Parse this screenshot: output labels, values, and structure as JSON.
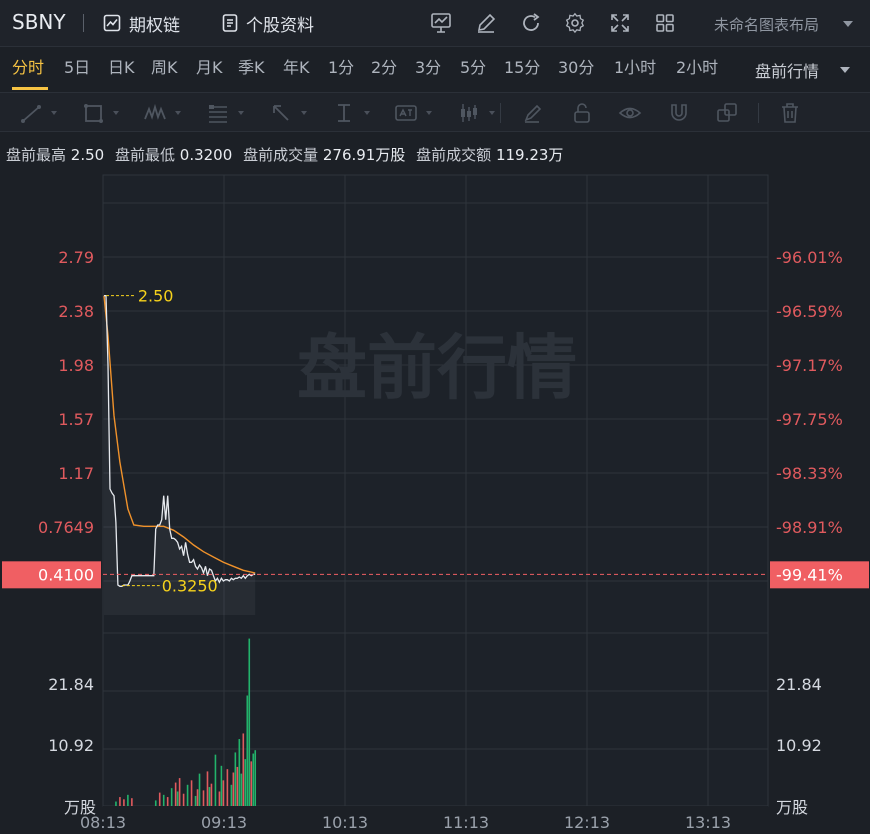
{
  "header": {
    "symbol": "SBNY",
    "option_chain": "期权链",
    "profile": "个股资料",
    "layout_name": "未命名图表布局",
    "icons": [
      "chart-settings-icon",
      "pen-icon",
      "refresh-icon",
      "gear-icon",
      "fullscreen-icon",
      "grid-layout-icon"
    ]
  },
  "periods": {
    "tabs": [
      "分时",
      "5日",
      "日K",
      "周K",
      "月K",
      "季K",
      "年K",
      "1分",
      "2分",
      "3分",
      "5分",
      "15分",
      "30分",
      "1小时",
      "2小时"
    ],
    "active": "分时",
    "session_select": "盘前行情"
  },
  "draw_tools": [
    "line-tool-icon",
    "rectangle-tool-icon",
    "pattern-tool-icon",
    "fib-tool-icon",
    "arrow-tool-icon",
    "measure-tool-icon",
    "text-tool-icon",
    "candle-tool-icon",
    "brush-icon",
    "unlock-icon",
    "eye-icon",
    "magnet-icon",
    "copy-icon",
    "trash-icon"
  ],
  "stats": {
    "high_label": "盘前最高",
    "high": "2.50",
    "low_label": "盘前最低",
    "low": "0.3200",
    "volume_label": "盘前成交量",
    "volume": "276.91万股",
    "turnover_label": "盘前成交额",
    "turnover": "119.23万"
  },
  "colors": {
    "up": "#e05a5e",
    "down": "#22b36b",
    "price_line": "#e6e9ee",
    "avg_line": "#f0922b",
    "marker": "#f6d21c",
    "current_bg": "#f05f63"
  },
  "chart_data": {
    "type": "line",
    "watermark": "盘前行情",
    "price_axis": {
      "ticks": [
        2.79,
        2.38,
        1.98,
        1.57,
        1.17,
        0.7649
      ],
      "tick_labels": [
        "2.79",
        "2.38",
        "1.98",
        "1.57",
        "1.17",
        "0.7649"
      ],
      "pct_labels": [
        "-96.01%",
        "-96.59%",
        "-97.17%",
        "-97.75%",
        "-98.33%",
        "-98.91%"
      ],
      "ylim": [
        0.32,
        3.2
      ]
    },
    "current": {
      "price": 0.41,
      "label": "0.4100",
      "pct": "-99.41%"
    },
    "max_marker": {
      "price": 2.5,
      "label": "2.50"
    },
    "min_marker": {
      "price": 0.325,
      "label": "0.3250"
    },
    "time_axis": {
      "labels": [
        "08:13",
        "09:13",
        "10:13",
        "11:13",
        "12:13",
        "13:13"
      ],
      "start": "08:13",
      "end": "13:43"
    },
    "price_series": {
      "name": "",
      "x": [
        0,
        1,
        2,
        3,
        4,
        5,
        6,
        7,
        8,
        9,
        10,
        11,
        12,
        13,
        14,
        15,
        16,
        17,
        18,
        19,
        20,
        21,
        22,
        23,
        24,
        25,
        26,
        27,
        28,
        29,
        30,
        31,
        32,
        33,
        34,
        35,
        36,
        37,
        38,
        39,
        40,
        41,
        42,
        43,
        44,
        45,
        46,
        47,
        48,
        49,
        50,
        51,
        52,
        53,
        54,
        55,
        56,
        57,
        58,
        59,
        60,
        61,
        62,
        63,
        64,
        65,
        66,
        67,
        68,
        69,
        70,
        71,
        72,
        73,
        74,
        75,
        76
      ],
      "values": [
        2.5,
        2.5,
        1.98,
        1.05,
        1.02,
        1.0,
        0.8,
        0.33,
        0.32,
        0.32,
        0.33,
        0.33,
        0.33,
        0.36,
        0.4,
        0.4,
        0.4,
        0.4,
        0.4,
        0.4,
        0.4,
        0.4,
        0.4,
        0.4,
        0.4,
        0.4,
        0.75,
        0.78,
        0.78,
        0.82,
        1.0,
        0.82,
        1.0,
        0.75,
        0.68,
        0.68,
        0.67,
        0.65,
        0.6,
        0.62,
        0.55,
        0.65,
        0.56,
        0.5,
        0.5,
        0.52,
        0.47,
        0.45,
        0.48,
        0.46,
        0.42,
        0.47,
        0.4,
        0.45,
        0.44,
        0.4,
        0.36,
        0.38,
        0.35,
        0.38,
        0.36,
        0.37,
        0.37,
        0.36,
        0.38,
        0.37,
        0.38,
        0.38,
        0.39,
        0.38,
        0.4,
        0.38,
        0.4,
        0.41,
        0.4,
        0.41,
        0.41
      ]
    },
    "avg_series": {
      "name": "",
      "x": [
        0,
        2,
        5,
        8,
        12,
        15,
        20,
        25,
        30,
        35,
        40,
        45,
        50,
        55,
        60,
        65,
        70,
        76
      ],
      "values": [
        2.5,
        2.2,
        1.6,
        1.25,
        0.9,
        0.78,
        0.77,
        0.77,
        0.77,
        0.74,
        0.69,
        0.63,
        0.58,
        0.54,
        0.5,
        0.47,
        0.44,
        0.42
      ]
    },
    "volume_axis": {
      "ticks": [
        21.84,
        10.92
      ],
      "tick_labels": [
        "21.84",
        "10.92"
      ],
      "unit": "万股",
      "ylim": [
        0,
        31
      ]
    },
    "volume_series": {
      "name": "",
      "x": [
        6,
        8,
        10,
        12,
        14,
        26,
        28,
        30,
        32,
        34,
        36,
        37,
        38,
        40,
        42,
        44,
        46,
        47,
        48,
        50,
        52,
        53,
        54,
        56,
        58,
        59,
        60,
        62,
        64,
        65,
        66,
        67,
        68,
        69,
        70,
        71,
        72,
        73,
        74,
        75,
        76
      ],
      "values": [
        0.8,
        1.6,
        1.2,
        2.0,
        1.4,
        1.0,
        2.4,
        2.0,
        1.6,
        3.2,
        4.2,
        2.6,
        5.0,
        2.2,
        3.8,
        4.6,
        1.8,
        3.0,
        5.8,
        2.8,
        6.2,
        3.4,
        4.0,
        9.2,
        2.6,
        7.2,
        4.6,
        6.6,
        3.8,
        6.0,
        9.6,
        7.0,
        12.0,
        5.8,
        13.0,
        8.4,
        19.8,
        30.0,
        8.0,
        9.4,
        10.0
      ],
      "up": [
        false,
        true,
        true,
        false,
        true,
        false,
        true,
        false,
        true,
        false,
        true,
        false,
        true,
        true,
        false,
        true,
        false,
        true,
        false,
        true,
        true,
        false,
        true,
        false,
        true,
        false,
        true,
        true,
        false,
        true,
        false,
        true,
        false,
        false,
        true,
        false,
        false,
        false,
        true,
        false,
        false
      ]
    }
  }
}
